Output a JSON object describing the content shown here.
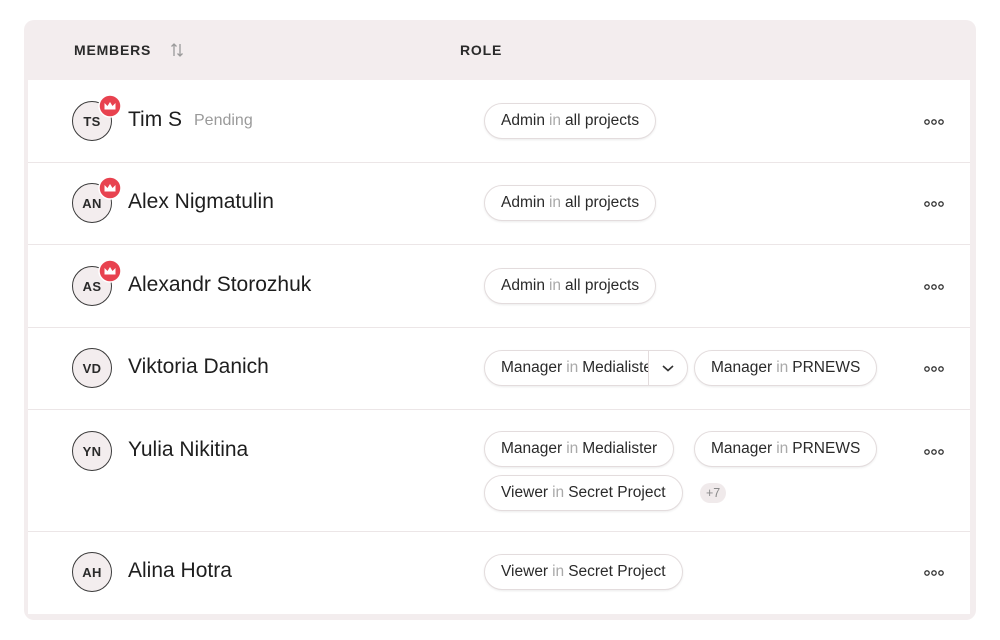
{
  "header": {
    "members_label": "MEMBERS",
    "role_label": "ROLE"
  },
  "connector": "in",
  "members": [
    {
      "initials": "TS",
      "name": "Tim S",
      "status": "Pending",
      "owner_badge": true,
      "roles": [
        {
          "role": "Admin",
          "scope": "all projects"
        }
      ]
    },
    {
      "initials": "AN",
      "name": "Alex Nigmatulin",
      "owner_badge": true,
      "roles": [
        {
          "role": "Admin",
          "scope": "all projects"
        }
      ]
    },
    {
      "initials": "AS",
      "name": "Alexandr Storozhuk",
      "owner_badge": true,
      "roles": [
        {
          "role": "Admin",
          "scope": "all projects"
        }
      ]
    },
    {
      "initials": "VD",
      "name": "Viktoria Danich",
      "owner_badge": false,
      "roles": [
        {
          "role": "Manager",
          "scope": "Medialister"
        },
        {
          "role": "Manager",
          "scope": "PRNEWS"
        }
      ]
    },
    {
      "initials": "YN",
      "name": "Yulia Nikitina",
      "owner_badge": false,
      "roles": [
        {
          "role": "Manager",
          "scope": "Medialister"
        },
        {
          "role": "Manager",
          "scope": "PRNEWS"
        },
        {
          "role": "Viewer",
          "scope": "Secret Project"
        }
      ],
      "more_count": "+7"
    },
    {
      "initials": "AH",
      "name": "Alina Hotra",
      "owner_badge": false,
      "roles": [
        {
          "role": "Viewer",
          "scope": "Secret Project"
        }
      ]
    }
  ],
  "icons": {
    "sort": "sort-arrows-icon",
    "owner": "crown-icon",
    "more": "more-dots-icon",
    "expand": "chevron-down-icon"
  },
  "colors": {
    "badge_red": "#e8424f",
    "panel_bg": "#f3edee",
    "muted_text": "#a9a9a9"
  }
}
